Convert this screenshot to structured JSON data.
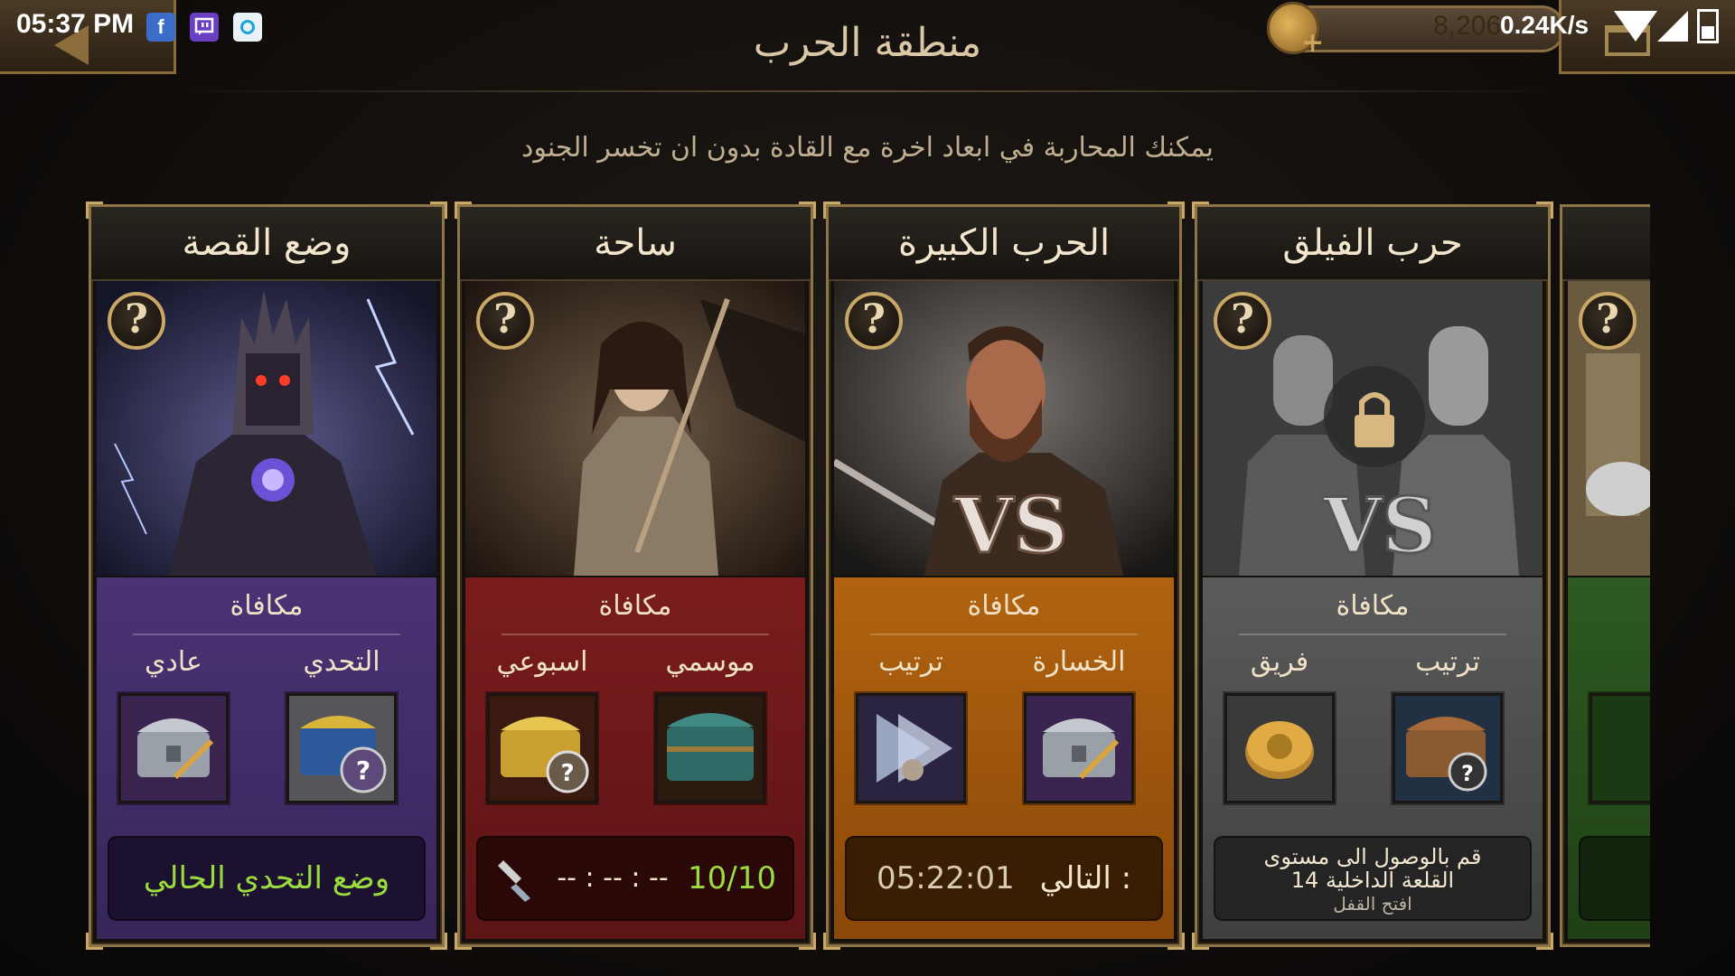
{
  "status_bar": {
    "time": "05:37 PM",
    "net_speed": "0.24K/s",
    "apps": [
      "f",
      "twitch-icon",
      "camera-icon"
    ]
  },
  "header": {
    "title": "منطقة الحرب",
    "resource_value": "8,206",
    "subtitle": "يمكنك المحاربة في ابعاد اخرة مع القادة بدون ان تخسر الجنود"
  },
  "reward_heading": "مكافاة",
  "cards": [
    {
      "title": "وضع القصة",
      "theme": "#4a3376",
      "reward_left_label": "عادي",
      "reward_right_label": "التحدي",
      "status": "وضع التحدي الحالي"
    },
    {
      "title": "ساحة",
      "theme": "#7b1c1d",
      "reward_left_label": "اسبوعي",
      "reward_right_label": "موسمي",
      "status_count": "10/10",
      "status_timer": "-- : -- : --"
    },
    {
      "title": "الحرب الكبيرة",
      "theme": "#b2630f",
      "reward_left_label": "ترتيب",
      "reward_right_label": "الخسارة",
      "status_prefix": "التالي :",
      "status_timer": "05:22:01"
    },
    {
      "title": "حرب الفيلق",
      "theme": "#5b5b5b",
      "reward_left_label": "فريق",
      "reward_right_label": "ترتيب",
      "status_line1": "قم بالوصول الى مستوى",
      "status_line2": "القلعة الداخلية 14",
      "status_line3": "افتح القفل"
    }
  ],
  "vs_label": "VS"
}
